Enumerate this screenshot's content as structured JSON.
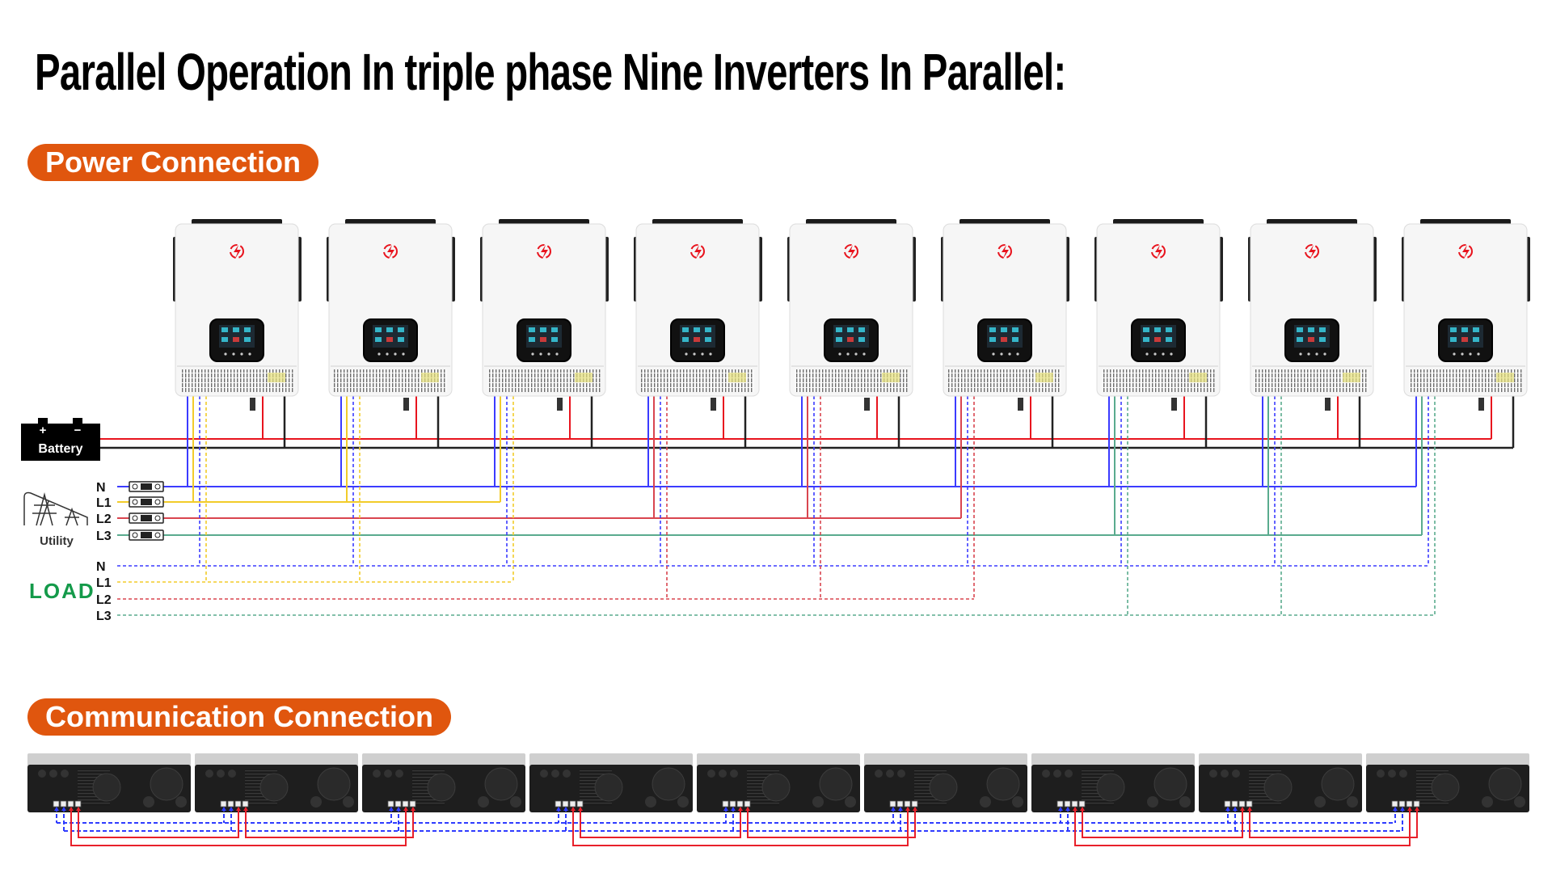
{
  "title": "Parallel Operation In triple phase Nine Inverters In Parallel:",
  "sections": {
    "power": "Power Connection",
    "communication": "Communication Connection"
  },
  "battery": {
    "label": "Battery",
    "plus": "+",
    "minus": "−"
  },
  "utility": {
    "label": "Utility",
    "lines": [
      "N",
      "L1",
      "L2",
      "L3"
    ]
  },
  "load": {
    "label": "LOAD",
    "lines": [
      "N",
      "L1",
      "L2",
      "L3"
    ]
  },
  "inverters": {
    "phases": [
      "L1",
      "L1",
      "L1",
      "L2",
      "L2",
      "L2",
      "L3",
      "L3",
      "L3"
    ]
  },
  "colors": {
    "accent": "#e0560e",
    "load_label": "#149a4a",
    "N": "#3b3bff",
    "L1": "#f2cc2a",
    "L2": "#d9454f",
    "L3": "#5aab8e",
    "battery_pos": "#e8141e",
    "battery_neg": "#222222",
    "comm_blue": "#2f3cff",
    "comm_red": "#e8202a"
  }
}
